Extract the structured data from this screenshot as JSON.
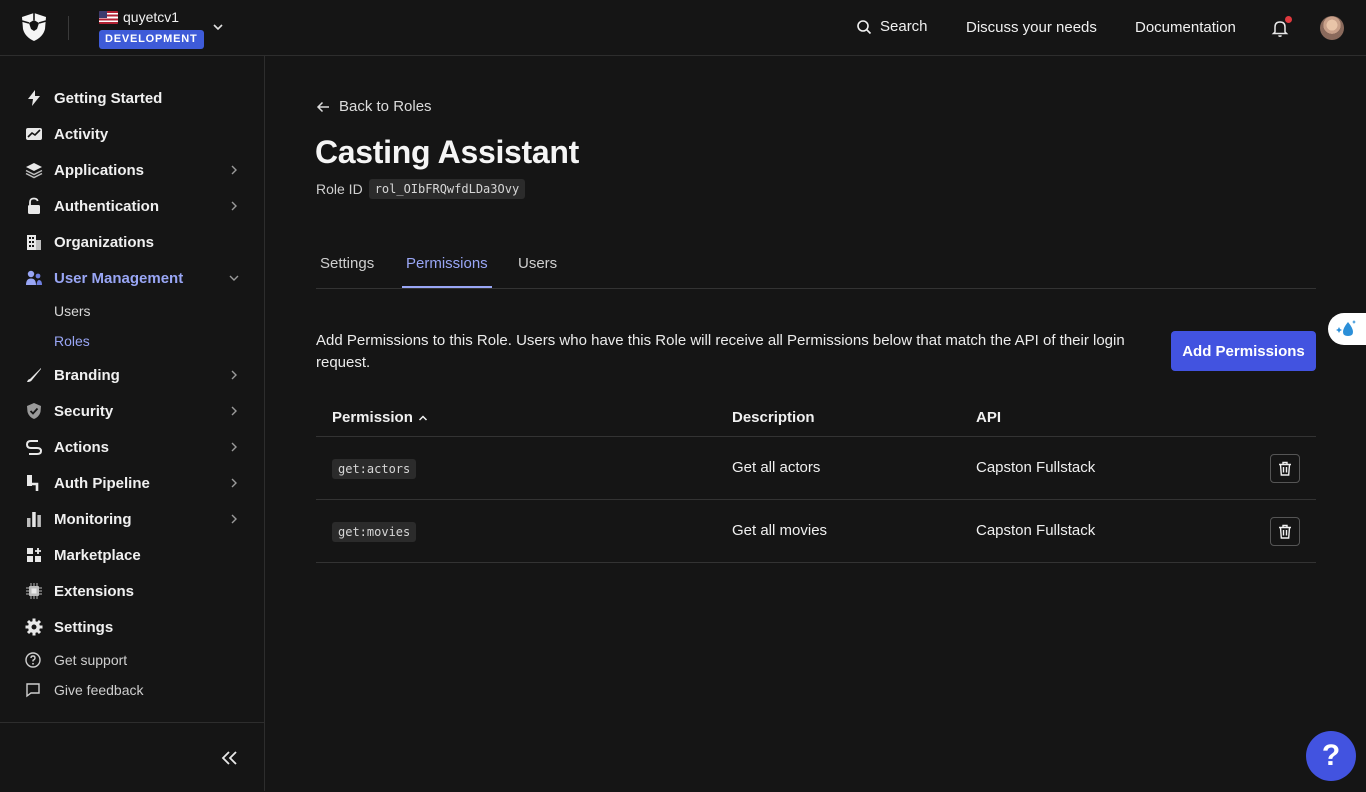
{
  "header": {
    "tenant_name": "quyetcv1",
    "environment": "DEVELOPMENT",
    "search_label": "Search",
    "links": [
      "Discuss your needs",
      "Documentation"
    ]
  },
  "sidebar": {
    "items": [
      {
        "label": "Getting Started",
        "icon": "lightning-icon"
      },
      {
        "label": "Activity",
        "icon": "activity-chart-icon"
      },
      {
        "label": "Applications",
        "icon": "layers-icon"
      },
      {
        "label": "Authentication",
        "icon": "lock-icon"
      },
      {
        "label": "Organizations",
        "icon": "building-icon"
      },
      {
        "label": "User Management",
        "icon": "users-icon"
      },
      {
        "label": "Branding",
        "icon": "brush-icon"
      },
      {
        "label": "Security",
        "icon": "shield-check-icon"
      },
      {
        "label": "Actions",
        "icon": "actions-flow-icon"
      },
      {
        "label": "Auth Pipeline",
        "icon": "pipeline-icon"
      },
      {
        "label": "Monitoring",
        "icon": "bar-chart-icon"
      },
      {
        "label": "Marketplace",
        "icon": "grid-plus-icon"
      },
      {
        "label": "Extensions",
        "icon": "chip-icon"
      },
      {
        "label": "Settings",
        "icon": "gear-icon"
      }
    ],
    "sub_items": [
      "Users",
      "Roles"
    ],
    "footer_links": [
      "Get support",
      "Give feedback"
    ]
  },
  "page": {
    "back_label": "Back to Roles",
    "title": "Casting Assistant",
    "role_id_label": "Role ID",
    "role_id": "rol_OIbFRQwfdLDa3Ovy"
  },
  "tabs": [
    "Settings",
    "Permissions",
    "Users"
  ],
  "permissions_section": {
    "intro": "Add Permissions to this Role. Users who have this Role will receive all Permissions below that match the API of their login request.",
    "add_button": "Add Permissions",
    "columns": [
      "Permission",
      "Description",
      "API"
    ],
    "rows": [
      {
        "permission": "get:actors",
        "description": "Get all actors",
        "api": "Capston Fullstack"
      },
      {
        "permission": "get:movies",
        "description": "Get all movies",
        "api": "Capston Fullstack"
      }
    ]
  },
  "help_label": "?",
  "colors": {
    "accent": "#4253e0",
    "active_link": "#99a6f5",
    "background": "#151515"
  }
}
